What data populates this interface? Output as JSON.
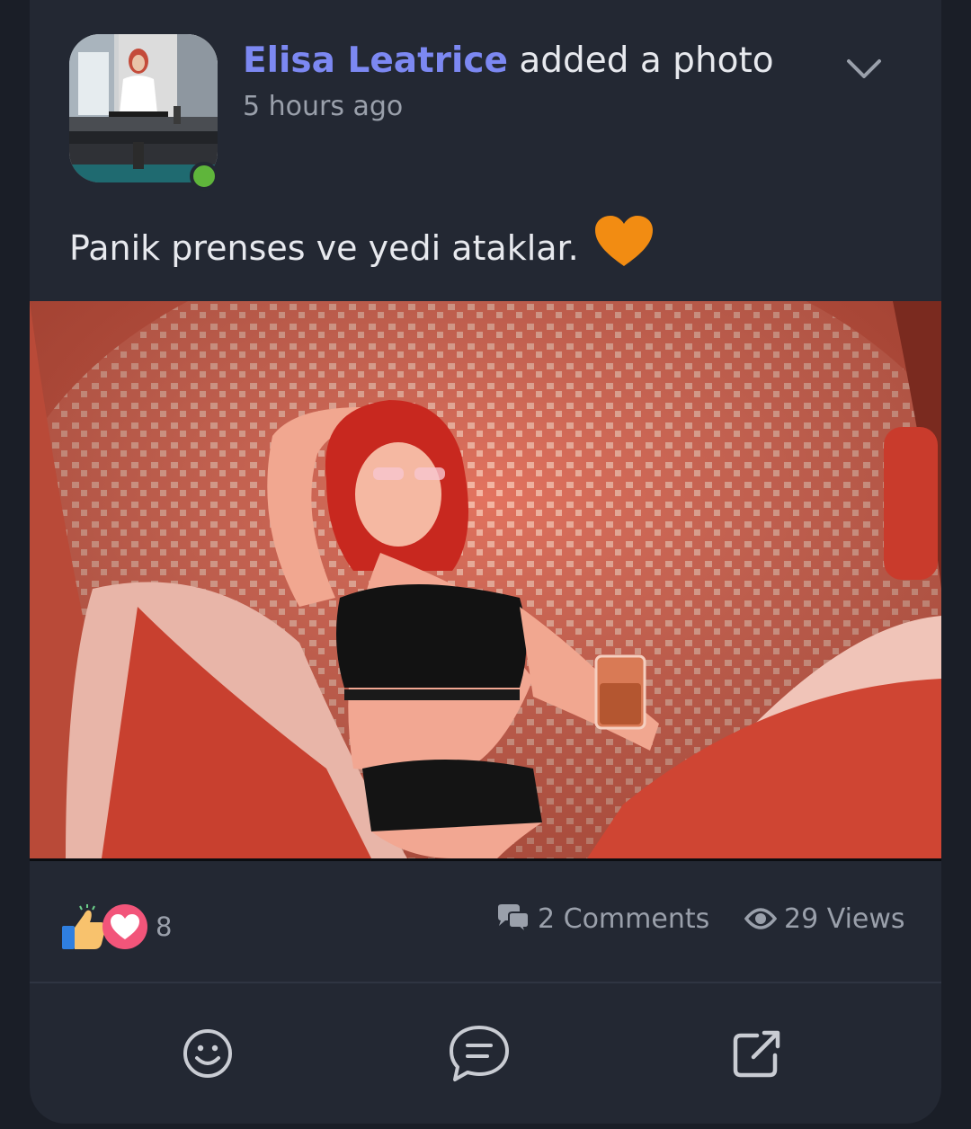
{
  "post": {
    "author": "Elisa Leatrice",
    "action": "added a photo",
    "timestamp": "5 hours ago",
    "text": "Panik prenses ve yedi ataklar.",
    "text_emoji": "orange-heart-icon",
    "author_online": true
  },
  "stats": {
    "reaction_count": "8",
    "reaction_icons": [
      "like-icon",
      "love-icon"
    ],
    "comments": "2 Comments",
    "views": "29 Views"
  },
  "actions": [
    "smiley-icon",
    "comment-icon",
    "share-icon"
  ],
  "colors": {
    "card_background": "#232833",
    "author_name": "#7c88f2",
    "online_dot": "#5fb53b",
    "heart_emoji": "#f28c12",
    "muted_text": "#9aa0ab"
  }
}
